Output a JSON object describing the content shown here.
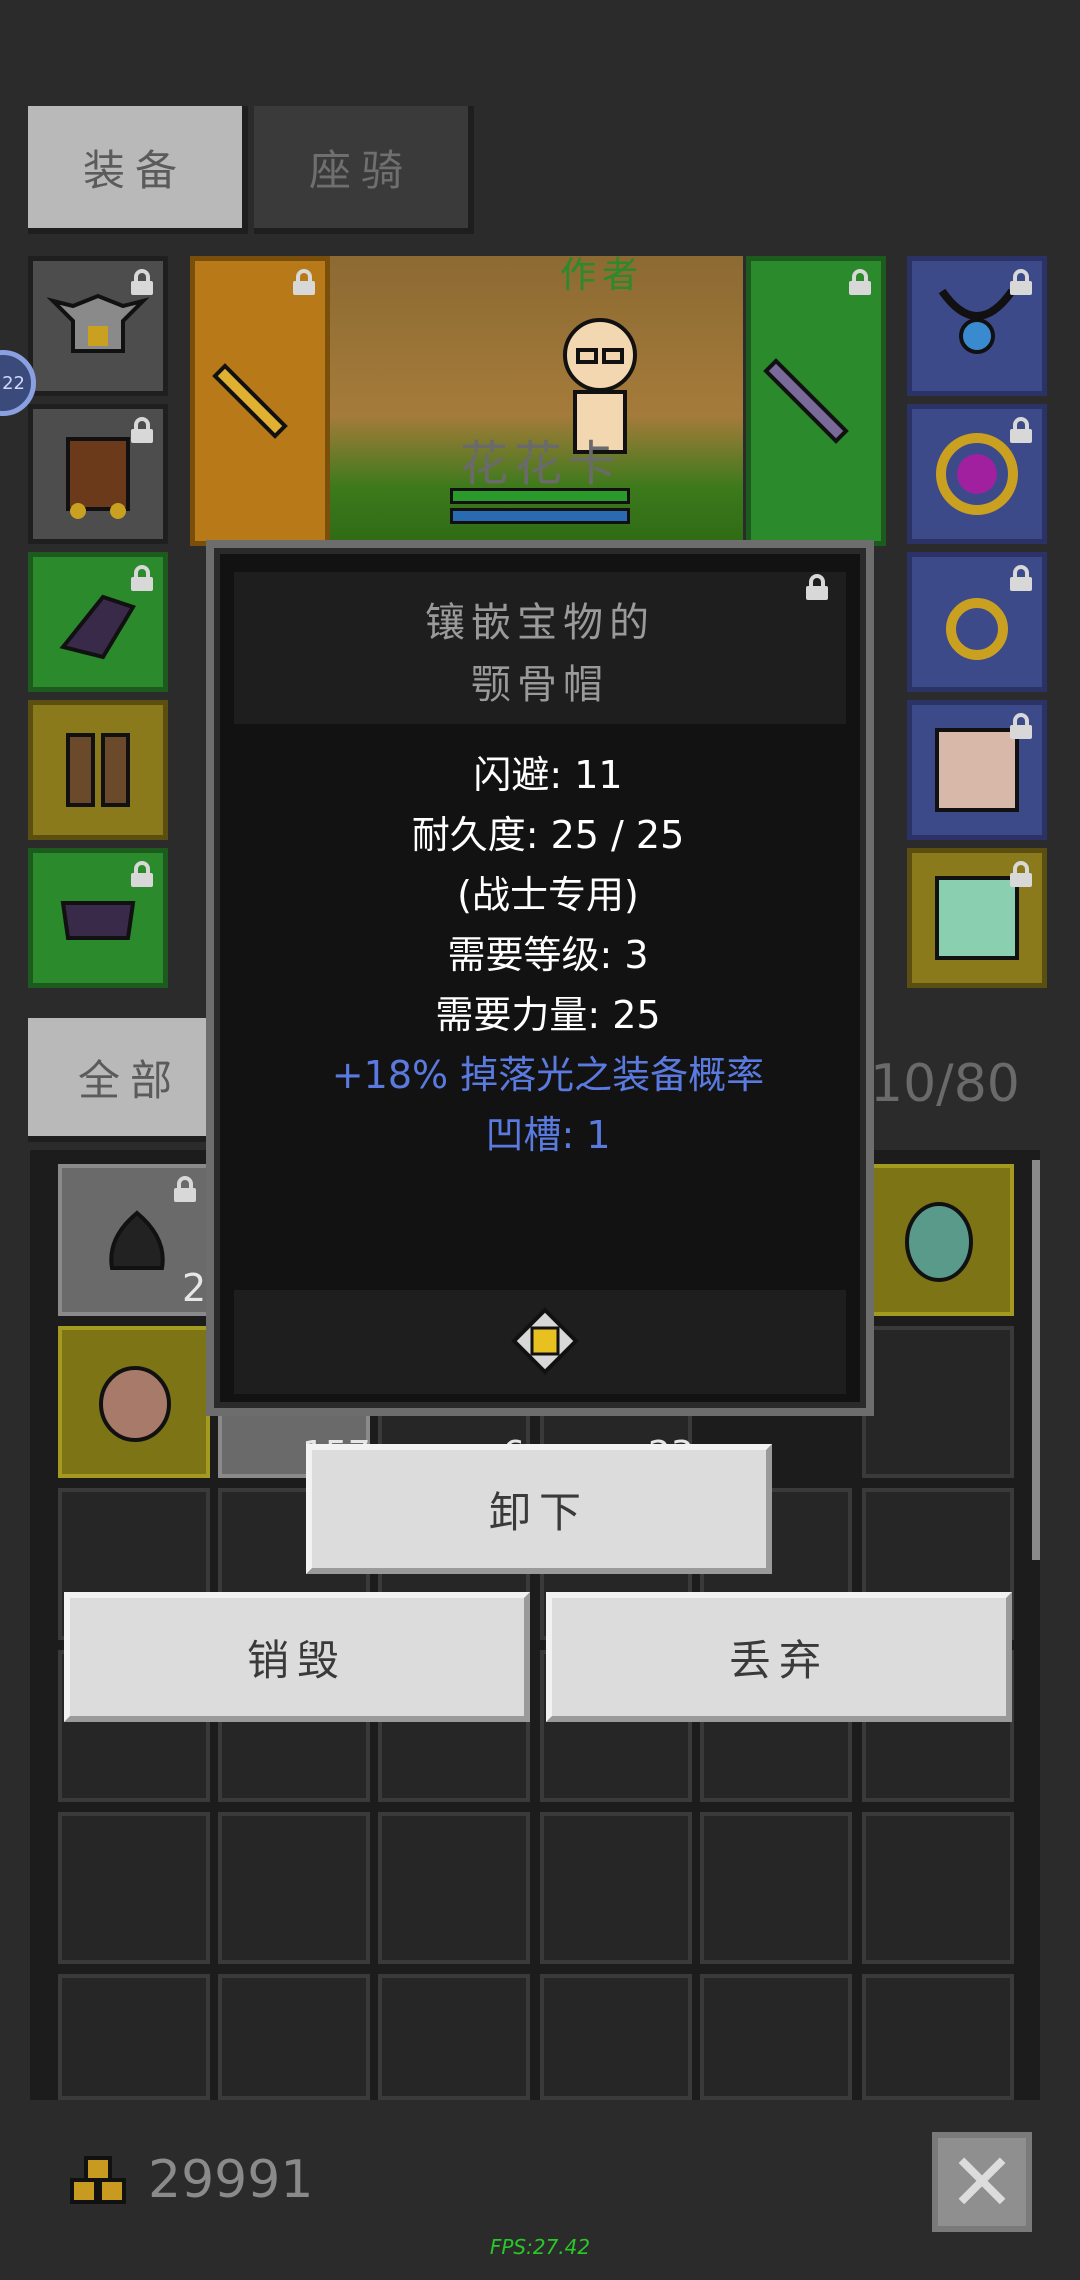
{
  "tabs": {
    "equipment": "装备",
    "mount": "座骑"
  },
  "side_badge": "22",
  "character": {
    "title_label": "作者",
    "name": "花花卡"
  },
  "filter": {
    "all_label": "全部",
    "capacity": "10/80"
  },
  "inventory": {
    "counts": {
      "slot_1": "2",
      "slot_7": "157",
      "slot_9": "6",
      "slot_10": "23"
    }
  },
  "tooltip": {
    "title_line1": "镶嵌宝物的",
    "title_line2": "颚骨帽",
    "stats": [
      "闪避: 11",
      "耐久度: 25 / 25",
      "(战士专用)",
      "需要等级: 3",
      "需要力量: 25"
    ],
    "bonus": "+18% 掉落光之装备概率",
    "sockets": "凹槽: 1"
  },
  "actions": {
    "unequip": "卸下",
    "destroy": "销毁",
    "discard": "丢弃"
  },
  "gold": "29991",
  "fps": "FPS:27.42",
  "colors": {
    "bonus_blue": "#5a7ae0",
    "fps_green": "#28c828",
    "slot_green": "#2b8a2b",
    "slot_blue": "#3c4a8a"
  },
  "icons": {
    "equip_slots": [
      "horned-helmet-icon",
      "chest-armor-icon",
      "glove-icon",
      "boots-icon",
      "pants-icon",
      "gold-sword-icon",
      "purple-sword-icon",
      "amulet-icon",
      "gem-ring-icon",
      "gold-ring-icon",
      "pet-portrait-icon",
      "green-pet-icon"
    ],
    "gold": "gold-pile-icon",
    "close": "close-icon",
    "lock": "lock-icon"
  }
}
